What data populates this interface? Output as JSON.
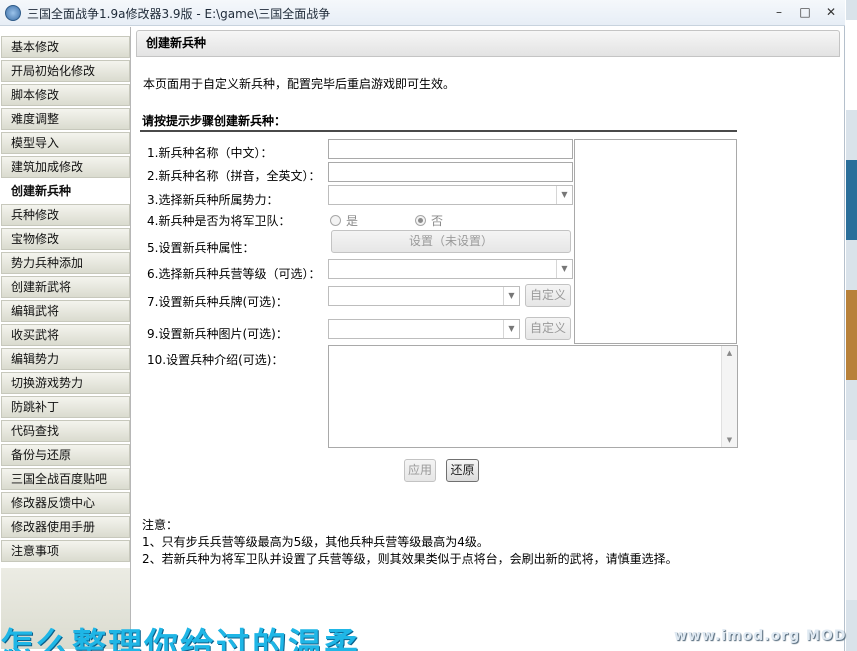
{
  "window": {
    "title": "三国全面战争1.9a修改器3.9版 - E:\\game\\三国全面战争",
    "buttons": {
      "minimize": "–",
      "maximize": "□",
      "close": "✕"
    }
  },
  "sidebar": {
    "items": [
      {
        "label": "基本修改"
      },
      {
        "label": "开局初始化修改"
      },
      {
        "label": "脚本修改"
      },
      {
        "label": "难度调整"
      },
      {
        "label": "模型导入"
      },
      {
        "label": "建筑加成修改"
      },
      {
        "label": "创建新兵种",
        "active": true
      },
      {
        "label": "兵种修改"
      },
      {
        "label": "宝物修改"
      },
      {
        "label": "势力兵种添加"
      },
      {
        "label": "创建新武将"
      },
      {
        "label": "编辑武将"
      },
      {
        "label": "收买武将"
      },
      {
        "label": "编辑势力"
      },
      {
        "label": "切换游戏势力"
      },
      {
        "label": "防跳补丁"
      },
      {
        "label": "代码查找"
      },
      {
        "label": "备份与还原"
      },
      {
        "label": "三国全战百度贴吧"
      },
      {
        "label": "修改器反馈中心"
      },
      {
        "label": "修改器使用手册"
      },
      {
        "label": "注意事项"
      }
    ]
  },
  "main": {
    "header": "创建新兵种",
    "description": "本页面用于自定义新兵种，配置完毕后重启游戏即可生效。",
    "section_title": "请按提示步骤创建新兵种：",
    "rows": {
      "name_cn": "1.新兵种名称（中文）：",
      "name_en": "2.新兵种名称（拼音，全英文）：",
      "faction": "3.选择新兵种所属势力：",
      "guard": "4.新兵种是否为将军卫队：",
      "attributes": "5.设置新兵种属性：",
      "barracks": "6.选择新兵种兵营等级（可选）：",
      "card": "7.设置新兵种兵牌(可选)：",
      "image": "9.设置新兵种图片(可选)：",
      "intro": "10.设置兵种介绍(可选)："
    },
    "inputs": {
      "name_cn": "",
      "name_en": "",
      "intro": ""
    },
    "selects": {
      "faction": "",
      "barracks": "",
      "card": "",
      "image": ""
    },
    "radio": {
      "yes": "是",
      "no": "否",
      "selected": "no"
    },
    "buttons": {
      "attributes": "设置（未设置）",
      "custom_card": "自定义",
      "custom_image": "自定义",
      "apply": "应用",
      "restore": "还原"
    },
    "notes": {
      "title": "注意：",
      "lines": [
        "1、只有步兵兵营等级最高为5级，其他兵种兵营等级最高为4级。",
        "2、若新兵种为将军卫队并设置了兵营等级，则其效果类似于点将台，会刷出新的武将，请慎重选择。"
      ]
    }
  },
  "overlay": {
    "subtitle": "怎么整理你给过的温柔",
    "watermark": "www.imod.org    MOD"
  },
  "colors": {
    "sidebar_item": "#dadbcf",
    "accent_subtitle": "#1fb6e6",
    "titlebar": "#e7eef6"
  }
}
